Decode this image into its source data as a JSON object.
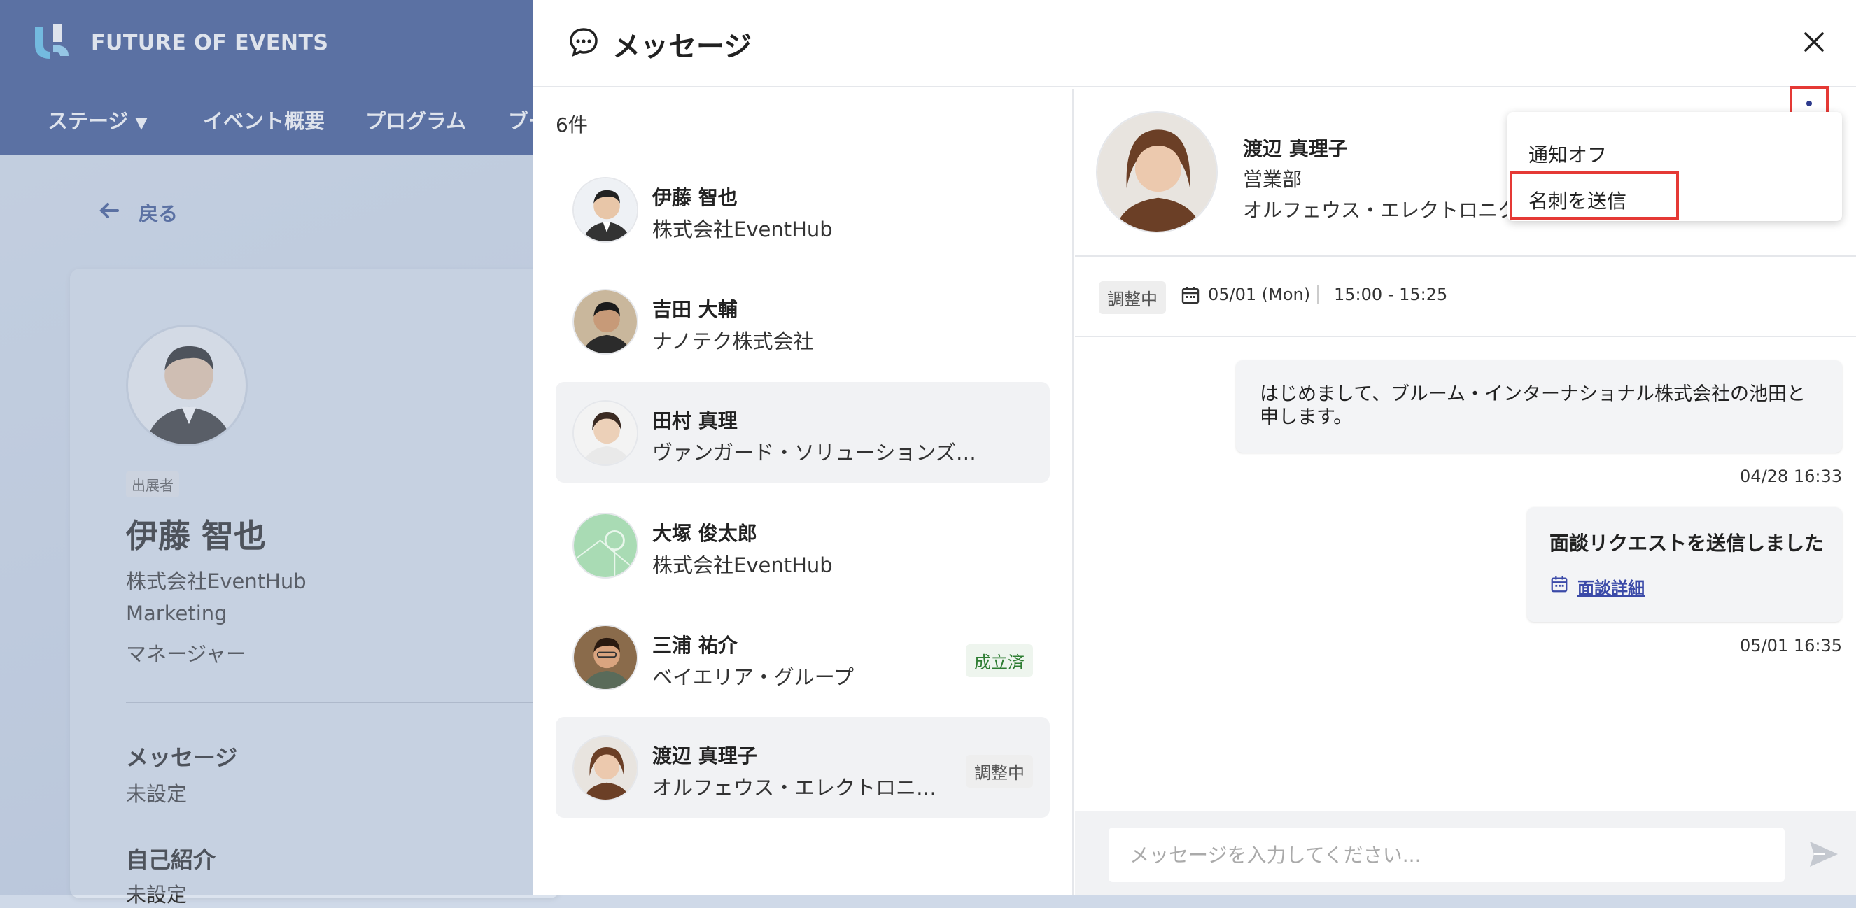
{
  "brand": {
    "name": "FUTURE OF EVENTS"
  },
  "nav": {
    "stage": "ステージ",
    "overview": "イベント概要",
    "program": "プログラム",
    "booth": "ブー"
  },
  "back_label": "戻る",
  "profile": {
    "tag": "出展者",
    "name": "伊藤 智也",
    "company": "株式会社EventHub",
    "dept": "Marketing",
    "role": "マネージャー",
    "message_title": "メッセージ",
    "message_value": "未設定",
    "intro_title": "自己紹介",
    "intro_value": "未設定"
  },
  "drawer": {
    "title": "メッセージ"
  },
  "list": {
    "count": "6件",
    "contacts": [
      {
        "name": "伊藤 智也",
        "org": "株式会社EventHub",
        "badge": ""
      },
      {
        "name": "吉田 大輔",
        "org": "ナノテク株式会社",
        "badge": ""
      },
      {
        "name": "田村 真理",
        "org": "ヴァンガード・ソリューションズ合同会社",
        "badge": ""
      },
      {
        "name": "大塚 俊太郎",
        "org": "株式会社EventHub",
        "badge": ""
      },
      {
        "name": "三浦 祐介",
        "org": "ベイエリア・グループ",
        "badge": "成立済"
      },
      {
        "name": "渡辺 真理子",
        "org": "オルフェウス・エレクトロニクス",
        "badge": "調整中"
      }
    ]
  },
  "conversation": {
    "name": "渡辺 真理子",
    "dept": "営業部",
    "org": "オルフェウス・エレクトロニク",
    "status": "調整中",
    "date": "05/01 (Mon)",
    "time": "15:00 - 15:25",
    "messages": [
      {
        "text": "はじめまして、ブルーム・インターナショナル株式会社の池田と申します。",
        "timestamp": "04/28 16:33"
      },
      {
        "title": "面談リクエストを送信しました",
        "link": "面談詳細",
        "timestamp": "05/01 16:35"
      }
    ],
    "input_placeholder": "メッセージを入力してください..."
  },
  "menu": {
    "items": [
      "通知オフ",
      "名刺を送信"
    ]
  },
  "colors": {
    "primary": "#36508f",
    "highlight": "#e53935",
    "success": "#2e7d32",
    "link": "#3b4aa8"
  }
}
